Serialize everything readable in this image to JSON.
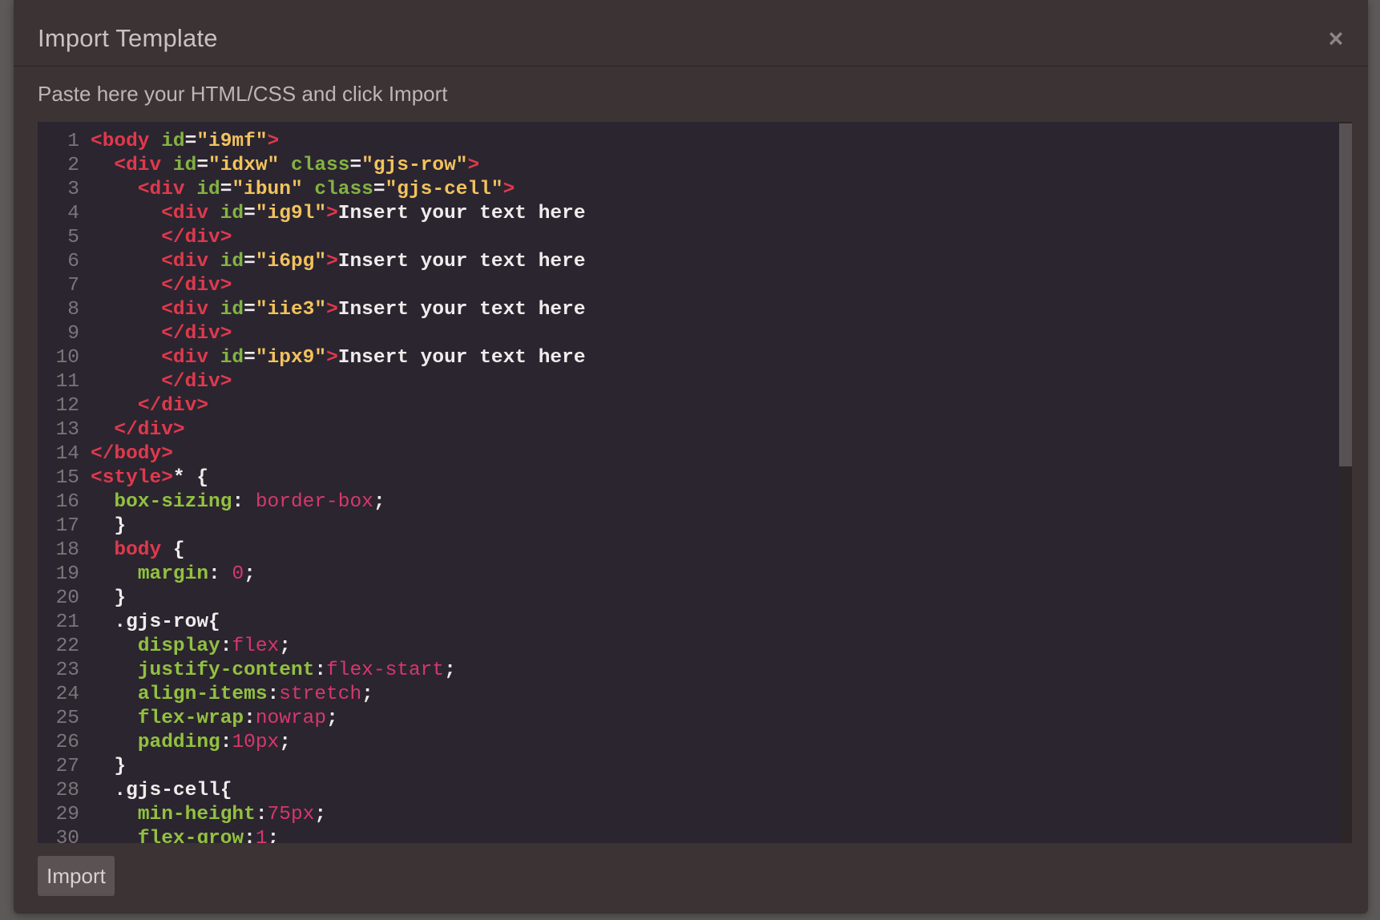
{
  "modal": {
    "title": "Import Template",
    "close_label": "×",
    "instructions": "Paste here your HTML/CSS and click Import",
    "import_label": "Import"
  },
  "colors": {
    "modal_bg": "#3c3334",
    "editor_bg": "#2b2530",
    "tag": "#e0394c",
    "attribute": "#83b341",
    "string": "#f2c35c",
    "value": "#d6386b"
  },
  "icons": {
    "close": "close-icon"
  },
  "code_lines": [
    {
      "n": "1",
      "tokens": [
        [
          "t-tag",
          "<body"
        ],
        [
          "t-text",
          " "
        ],
        [
          "t-attr",
          "id"
        ],
        [
          "t-punc",
          "="
        ],
        [
          "t-str",
          "\"i9mf\""
        ],
        [
          "t-tag",
          ">"
        ]
      ]
    },
    {
      "n": "2",
      "tokens": [
        [
          "t-text",
          "  "
        ],
        [
          "t-tag",
          "<div"
        ],
        [
          "t-text",
          " "
        ],
        [
          "t-attr",
          "id"
        ],
        [
          "t-punc",
          "="
        ],
        [
          "t-str",
          "\"idxw\""
        ],
        [
          "t-text",
          " "
        ],
        [
          "t-attr",
          "class"
        ],
        [
          "t-punc",
          "="
        ],
        [
          "t-str",
          "\"gjs-row\""
        ],
        [
          "t-tag",
          ">"
        ]
      ]
    },
    {
      "n": "3",
      "tokens": [
        [
          "t-text",
          "    "
        ],
        [
          "t-tag",
          "<div"
        ],
        [
          "t-text",
          " "
        ],
        [
          "t-attr",
          "id"
        ],
        [
          "t-punc",
          "="
        ],
        [
          "t-str",
          "\"ibun\""
        ],
        [
          "t-text",
          " "
        ],
        [
          "t-attr",
          "class"
        ],
        [
          "t-punc",
          "="
        ],
        [
          "t-str",
          "\"gjs-cell\""
        ],
        [
          "t-tag",
          ">"
        ]
      ]
    },
    {
      "n": "4",
      "tokens": [
        [
          "t-text",
          "      "
        ],
        [
          "t-tag",
          "<div"
        ],
        [
          "t-text",
          " "
        ],
        [
          "t-attr",
          "id"
        ],
        [
          "t-punc",
          "="
        ],
        [
          "t-str",
          "\"ig9l\""
        ],
        [
          "t-tag",
          ">"
        ],
        [
          "t-text",
          "Insert your text here"
        ]
      ]
    },
    {
      "n": "5",
      "tokens": [
        [
          "t-text",
          "      "
        ],
        [
          "t-tag",
          "</div>"
        ]
      ]
    },
    {
      "n": "6",
      "tokens": [
        [
          "t-text",
          "      "
        ],
        [
          "t-tag",
          "<div"
        ],
        [
          "t-text",
          " "
        ],
        [
          "t-attr",
          "id"
        ],
        [
          "t-punc",
          "="
        ],
        [
          "t-str",
          "\"i6pg\""
        ],
        [
          "t-tag",
          ">"
        ],
        [
          "t-text",
          "Insert your text here"
        ]
      ]
    },
    {
      "n": "7",
      "tokens": [
        [
          "t-text",
          "      "
        ],
        [
          "t-tag",
          "</div>"
        ]
      ]
    },
    {
      "n": "8",
      "tokens": [
        [
          "t-text",
          "      "
        ],
        [
          "t-tag",
          "<div"
        ],
        [
          "t-text",
          " "
        ],
        [
          "t-attr",
          "id"
        ],
        [
          "t-punc",
          "="
        ],
        [
          "t-str",
          "\"iie3\""
        ],
        [
          "t-tag",
          ">"
        ],
        [
          "t-text",
          "Insert your text here"
        ]
      ]
    },
    {
      "n": "9",
      "tokens": [
        [
          "t-text",
          "      "
        ],
        [
          "t-tag",
          "</div>"
        ]
      ]
    },
    {
      "n": "10",
      "tokens": [
        [
          "t-text",
          "      "
        ],
        [
          "t-tag",
          "<div"
        ],
        [
          "t-text",
          " "
        ],
        [
          "t-attr",
          "id"
        ],
        [
          "t-punc",
          "="
        ],
        [
          "t-str",
          "\"ipx9\""
        ],
        [
          "t-tag",
          ">"
        ],
        [
          "t-text",
          "Insert your text here"
        ]
      ]
    },
    {
      "n": "11",
      "tokens": [
        [
          "t-text",
          "      "
        ],
        [
          "t-tag",
          "</div>"
        ]
      ]
    },
    {
      "n": "12",
      "tokens": [
        [
          "t-text",
          "    "
        ],
        [
          "t-tag",
          "</div>"
        ]
      ]
    },
    {
      "n": "13",
      "tokens": [
        [
          "t-text",
          "  "
        ],
        [
          "t-tag",
          "</div>"
        ]
      ]
    },
    {
      "n": "14",
      "tokens": [
        [
          "t-tag",
          "</body>"
        ]
      ]
    },
    {
      "n": "15",
      "tokens": [
        [
          "t-tag",
          "<style>"
        ],
        [
          "t-sel",
          "* {"
        ]
      ]
    },
    {
      "n": "16",
      "tokens": [
        [
          "t-text",
          "  "
        ],
        [
          "t-prop",
          "box-sizing"
        ],
        [
          "t-punc",
          ": "
        ],
        [
          "t-val",
          "border-box"
        ],
        [
          "t-punc",
          ";"
        ]
      ]
    },
    {
      "n": "17",
      "tokens": [
        [
          "t-text",
          "  "
        ],
        [
          "t-punc",
          "}"
        ]
      ]
    },
    {
      "n": "18",
      "tokens": [
        [
          "t-text",
          "  "
        ],
        [
          "t-tag",
          "body"
        ],
        [
          "t-punc",
          " {"
        ]
      ]
    },
    {
      "n": "19",
      "tokens": [
        [
          "t-text",
          "    "
        ],
        [
          "t-prop",
          "margin"
        ],
        [
          "t-punc",
          ": "
        ],
        [
          "t-val",
          "0"
        ],
        [
          "t-punc",
          ";"
        ]
      ]
    },
    {
      "n": "20",
      "tokens": [
        [
          "t-text",
          "  "
        ],
        [
          "t-punc",
          "}"
        ]
      ]
    },
    {
      "n": "21",
      "tokens": [
        [
          "t-text",
          "  "
        ],
        [
          "t-sel",
          ".gjs-row{"
        ]
      ]
    },
    {
      "n": "22",
      "tokens": [
        [
          "t-text",
          "    "
        ],
        [
          "t-prop",
          "display"
        ],
        [
          "t-punc",
          ":"
        ],
        [
          "t-val",
          "flex"
        ],
        [
          "t-punc",
          ";"
        ]
      ]
    },
    {
      "n": "23",
      "tokens": [
        [
          "t-text",
          "    "
        ],
        [
          "t-prop",
          "justify-content"
        ],
        [
          "t-punc",
          ":"
        ],
        [
          "t-val",
          "flex-start"
        ],
        [
          "t-punc",
          ";"
        ]
      ]
    },
    {
      "n": "24",
      "tokens": [
        [
          "t-text",
          "    "
        ],
        [
          "t-prop",
          "align-items"
        ],
        [
          "t-punc",
          ":"
        ],
        [
          "t-val",
          "stretch"
        ],
        [
          "t-punc",
          ";"
        ]
      ]
    },
    {
      "n": "25",
      "tokens": [
        [
          "t-text",
          "    "
        ],
        [
          "t-prop",
          "flex-wrap"
        ],
        [
          "t-punc",
          ":"
        ],
        [
          "t-val",
          "nowrap"
        ],
        [
          "t-punc",
          ";"
        ]
      ]
    },
    {
      "n": "26",
      "tokens": [
        [
          "t-text",
          "    "
        ],
        [
          "t-prop",
          "padding"
        ],
        [
          "t-punc",
          ":"
        ],
        [
          "t-val",
          "10px"
        ],
        [
          "t-punc",
          ";"
        ]
      ]
    },
    {
      "n": "27",
      "tokens": [
        [
          "t-text",
          "  "
        ],
        [
          "t-punc",
          "}"
        ]
      ]
    },
    {
      "n": "28",
      "tokens": [
        [
          "t-text",
          "  "
        ],
        [
          "t-sel",
          ".gjs-cell{"
        ]
      ]
    },
    {
      "n": "29",
      "tokens": [
        [
          "t-text",
          "    "
        ],
        [
          "t-prop",
          "min-height"
        ],
        [
          "t-punc",
          ":"
        ],
        [
          "t-val",
          "75px"
        ],
        [
          "t-punc",
          ";"
        ]
      ]
    },
    {
      "n": "30",
      "tokens": [
        [
          "t-text",
          "    "
        ],
        [
          "t-prop",
          "flex-grow"
        ],
        [
          "t-punc",
          ":"
        ],
        [
          "t-val",
          "1"
        ],
        [
          "t-punc",
          ";"
        ]
      ]
    }
  ]
}
